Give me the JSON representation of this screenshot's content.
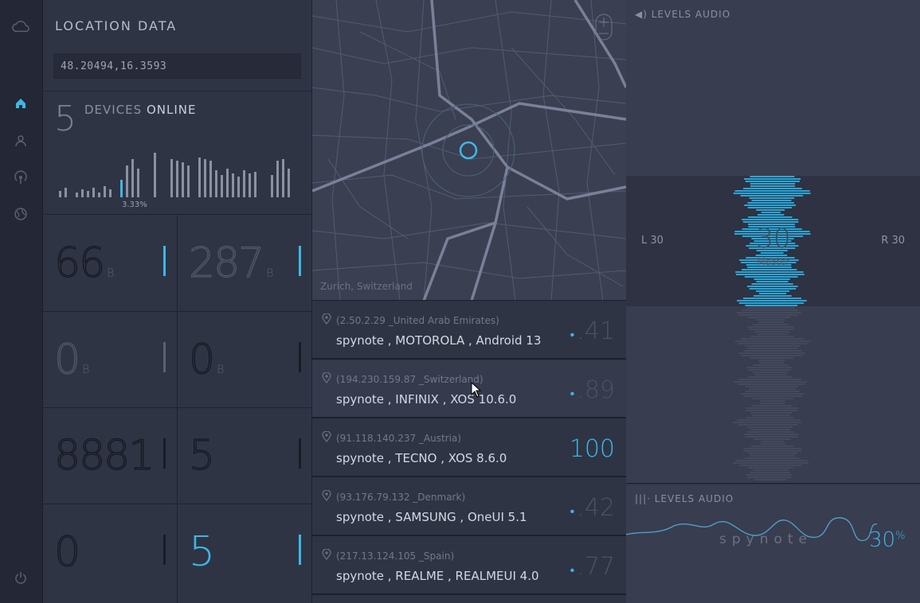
{
  "sidebar": {
    "icons": [
      "cloud-icon",
      "home-icon",
      "user-icon",
      "antenna-icon",
      "globe-icon",
      "power-icon"
    ],
    "active": "home-icon",
    "accent": "#3db8e6"
  },
  "location": {
    "title": "LOCATION DATA",
    "coords": "48.20494,16.3593"
  },
  "devices": {
    "count": "5",
    "label_prefix": "DEVICES",
    "label_suffix": "ONLINE",
    "percent": "3.33%"
  },
  "stats": [
    {
      "value": "66",
      "unit": "B"
    },
    {
      "value": "287",
      "unit": "B"
    },
    {
      "value": "0",
      "unit": "B"
    },
    {
      "value": "0",
      "unit": "B"
    },
    {
      "value": "8881",
      "unit": ""
    },
    {
      "value": "5",
      "unit": ""
    },
    {
      "value": "0",
      "unit": ""
    },
    {
      "value": "5",
      "unit": ""
    }
  ],
  "map": {
    "caption": "Zurich, Switzerland"
  },
  "list": [
    {
      "addr": "(2.50.2.29 _United Arab Emirates)",
      "device": "spynote , MOTOROLA , Android 13",
      "value": ".41"
    },
    {
      "addr": "(194.230.159.87 _Switzerland)",
      "device": "spynote , INFINIX , XOS 10.6.0",
      "value": ".89"
    },
    {
      "addr": "(91.118.140.237 _Austria)",
      "device": "spynote , TECNO , XOS 8.6.0",
      "value": "100"
    },
    {
      "addr": "(93.176.79.132 _Denmark)",
      "device": "spynote , SAMSUNG , OneUI 5.1",
      "value": ".42"
    },
    {
      "addr": "(217.13.124.105 _Spain)",
      "device": "spynote , REALME , REALMEUI 4.0",
      "value": ".77"
    }
  ],
  "audio": {
    "title": "LEVELS AUDIO",
    "left": "L 30",
    "right": "R 30",
    "master_value": "30",
    "master_label": "Master"
  },
  "audio2": {
    "title": "LEVELS AUDIO",
    "brand": "spynote",
    "percent": "30",
    "percent_sign": "%"
  }
}
